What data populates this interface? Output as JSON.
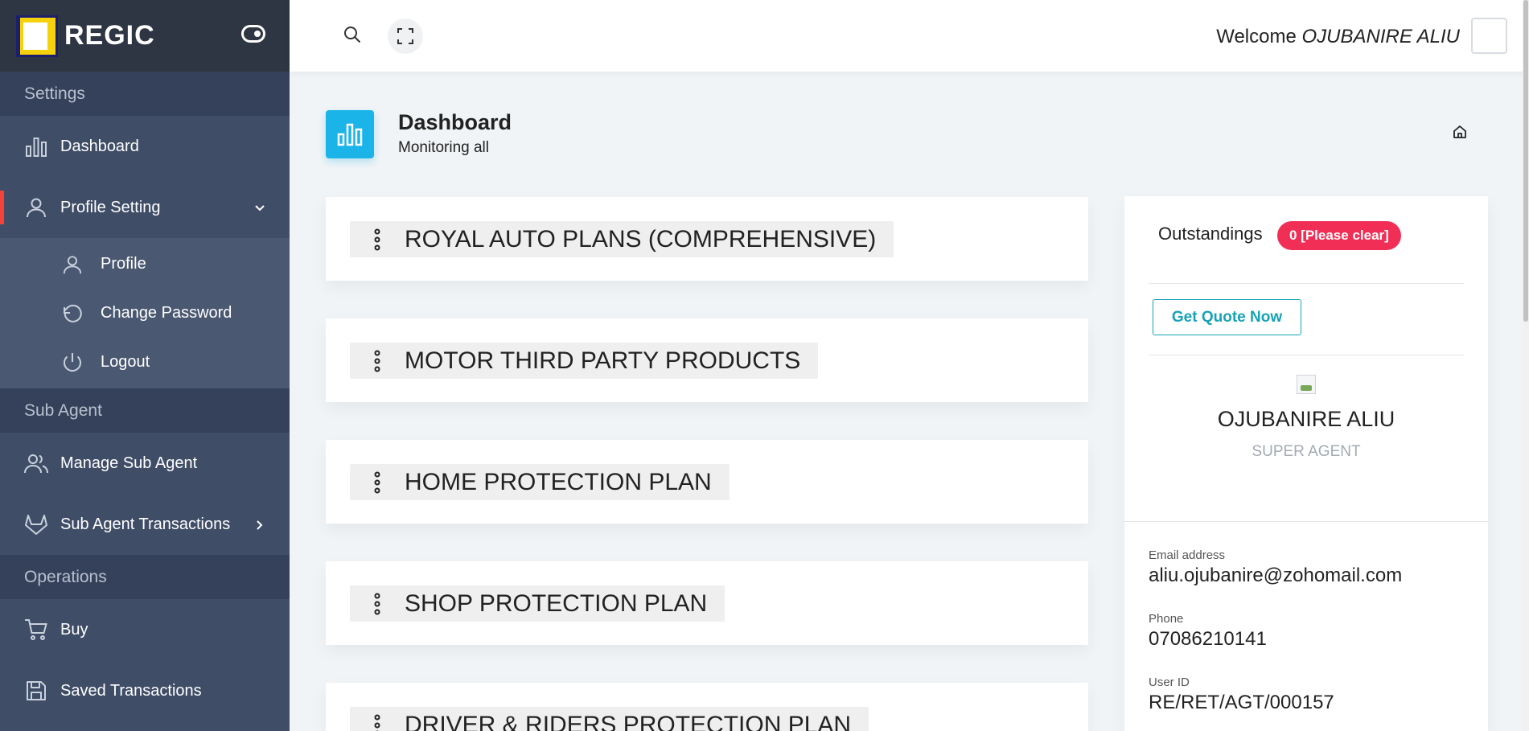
{
  "brand": {
    "name": "REGIC"
  },
  "sidebar": {
    "sections": {
      "settings": "Settings",
      "sub_agent": "Sub Agent",
      "operations": "Operations"
    },
    "items": {
      "dashboard": "Dashboard",
      "profile_setting": "Profile Setting",
      "manage_sub_agent": "Manage Sub Agent",
      "sub_agent_transactions": "Sub Agent Transactions",
      "buy": "Buy",
      "saved_transactions": "Saved Transactions"
    },
    "submenu": {
      "profile": "Profile",
      "change_password": "Change Password",
      "logout": "Logout"
    }
  },
  "header": {
    "welcome": "Welcome",
    "user_name": "OJUBANIRE ALIU"
  },
  "page": {
    "title": "Dashboard",
    "subtitle": "Monitoring all"
  },
  "plans": [
    "ROYAL AUTO PLANS (COMPREHENSIVE)",
    "MOTOR THIRD PARTY PRODUCTS",
    "HOME PROTECTION PLAN",
    "SHOP PROTECTION PLAN",
    "DRIVER & RIDERS PROTECTION PLAN"
  ],
  "profile_card": {
    "outstandings_label": "Outstandings",
    "outstandings_badge": "0 [Please clear]",
    "quote_button": "Get Quote Now",
    "name": "OJUBANIRE ALIU",
    "role": "SUPER AGENT",
    "email_label": "Email address",
    "email": "aliu.ojubanire@zohomail.com",
    "phone_label": "Phone",
    "phone": "07086210141",
    "userid_label": "User ID",
    "userid": "RE/RET/AGT/000157"
  },
  "colors": {
    "sidebar_bg": "#3f4d67",
    "brand_bg": "#2f3643",
    "active_marker": "#f44236",
    "dashboard_icon_bg": "#1ab4e8",
    "badge_bg": "#f12e55",
    "quote_button": "#17a2b8"
  }
}
